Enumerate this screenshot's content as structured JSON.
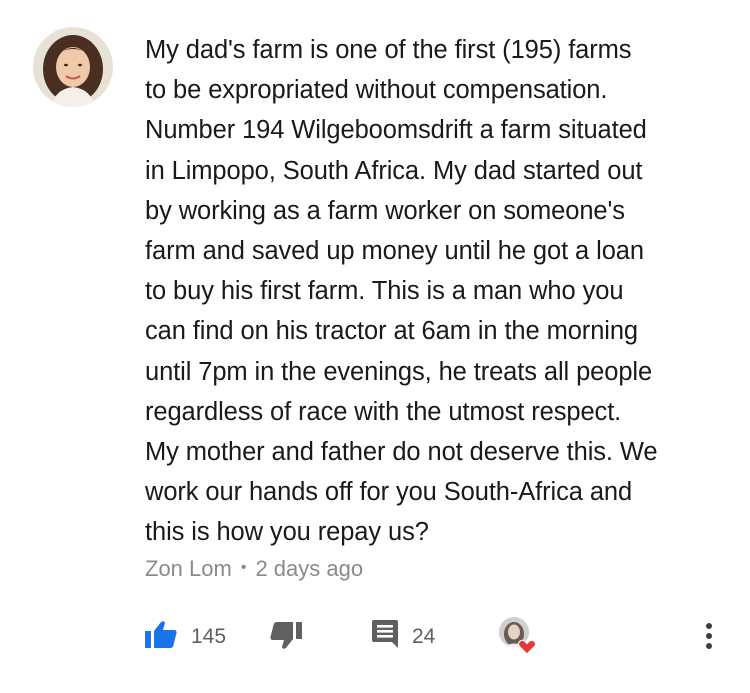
{
  "comment": {
    "text": "My dad's farm is one of the first (195) farms\nto be expropriated without compensation.\nNumber 194 Wilgeboomsdrift a farm situated\nin Limpopo, South Africa. My dad started out\nby working as a farm worker on someone's\nfarm and saved up money until he got a loan\nto buy his first farm. This is a man who you\ncan find on his tractor at 6am in the morning\nuntil 7pm in the evenings, he treats all people\nregardless of race with the utmost respect.\nMy mother and father do not deserve this. We\nwork our hands off for you South-Africa and\nthis is how you repay us?",
    "author": "Zon Lom",
    "separator": "•",
    "time": "2 days ago"
  },
  "actions": {
    "like_count": "145",
    "reply_count": "24"
  },
  "icons": {
    "like": "thumbs-up-icon",
    "dislike": "thumbs-down-icon",
    "reply": "comment-icon",
    "creator_heart": "creator-heart-icon",
    "more": "more-vertical-icon"
  },
  "colors": {
    "accent_blue": "#1a73e8",
    "icon_gray": "#606060",
    "meta_gray": "#8a8a8a",
    "heart_red": "#e53935"
  }
}
